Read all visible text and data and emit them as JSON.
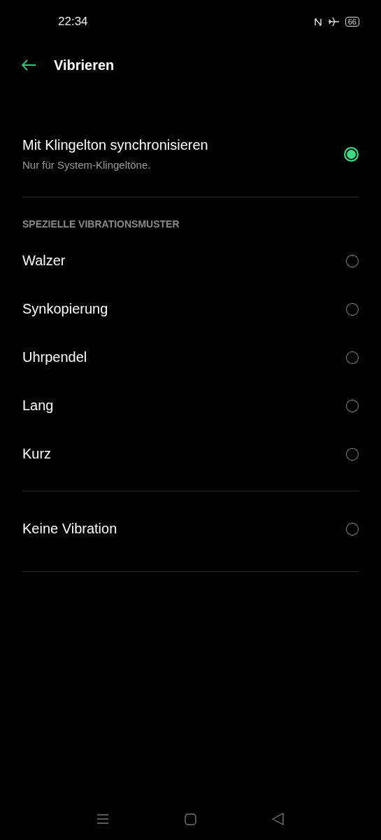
{
  "status_bar": {
    "time": "22:34",
    "battery": "66"
  },
  "header": {
    "title": "Vibrieren"
  },
  "sync": {
    "title": "Mit Klingelton synchronisieren",
    "subtitle": "Nur für System-Klingeltöne.",
    "checked": true
  },
  "section_header": "SPEZIELLE VIBRATIONSMUSTER",
  "pattern_groups": [
    [
      {
        "label": "Walzer",
        "selected": false
      },
      {
        "label": "Synkopierung",
        "selected": false
      },
      {
        "label": "Uhrpendel",
        "selected": false
      },
      {
        "label": "Lang",
        "selected": false
      },
      {
        "label": "Kurz",
        "selected": false
      }
    ],
    [
      {
        "label": "Keine Vibration",
        "selected": false
      }
    ]
  ]
}
